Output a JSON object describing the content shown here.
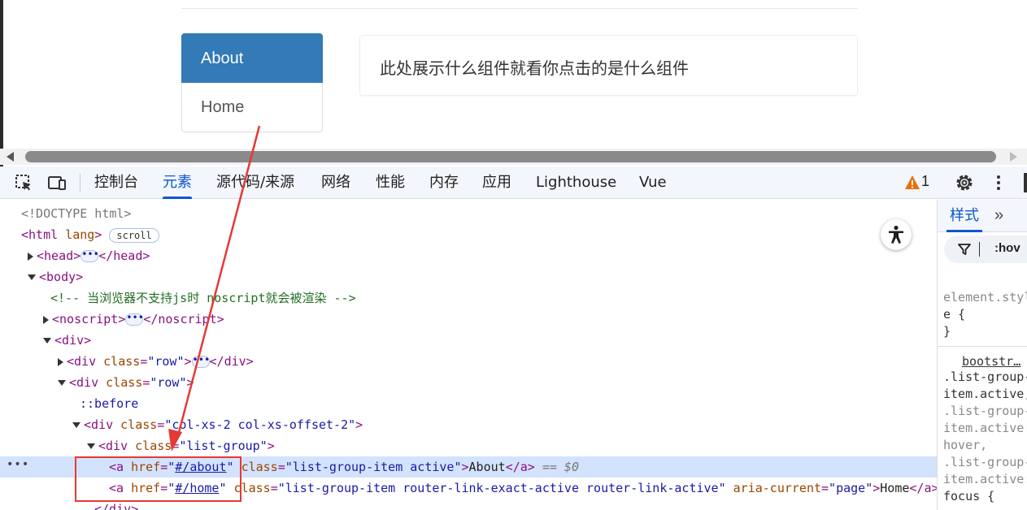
{
  "page": {
    "list_group": [
      "About",
      "Home"
    ],
    "panel_text": "此处展示什么组件就看你点击的是什么组件"
  },
  "devtools": {
    "tabs": [
      "控制台",
      "元素",
      "源代码/来源",
      "网络",
      "性能",
      "内存",
      "应用",
      "Lighthouse",
      "Vue"
    ],
    "active_tab": "元素",
    "warning_count": "1",
    "tree": {
      "doctype": "<!DOCTYPE html>",
      "html_open": "<html",
      "html_attr": "lang",
      "html_close_bracket": ">",
      "scroll_badge": "scroll",
      "head_open": "<head>",
      "head_close": "</head>",
      "body_open": "<body>",
      "comment": "<!-- 当浏览器不支持js时 noscript就会被渲染 -->",
      "noscript_open": "<noscript>",
      "noscript_close": "</noscript>",
      "div_open": "<div>",
      "div_tag": "<div",
      "div_close": "</div>",
      "class_attr": "class",
      "row_value": "\"row\"",
      "close_bracket": ">",
      "before": "::before",
      "col_value": "\"col-xs-2 col-xs-offset-2\"",
      "list_group_value": "\"list-group\"",
      "a_tag": "<a",
      "href_attr": "href",
      "eq": "=",
      "quote": "\"",
      "about_href": "#/about",
      "home_href": "#/home",
      "about_class": "\"list-group-item active\"",
      "home_class": "\"list-group-item router-link-exact-active router-link-active\"",
      "aria_attr": "aria-current",
      "aria_value": "\"page\"",
      "about_text": "About",
      "home_text": "Home",
      "a_close": "</a>",
      "dollar0": "== $0",
      "ellipsis": "•••"
    },
    "styles": {
      "tab": "样式",
      "more": "»",
      "hov": ":hov",
      "lines": [
        "element.styl",
        "e {",
        "}",
        "bootstr…",
        ".list-group-",
        "item.active,",
        ".list-group-",
        "item.active:",
        "hover,",
        ".list-group-",
        "item.active:",
        "focus {"
      ]
    }
  },
  "colors": {
    "active_item": "#337ab7",
    "annotation": "#e53935",
    "devtools_accent": "#0b57d0"
  }
}
